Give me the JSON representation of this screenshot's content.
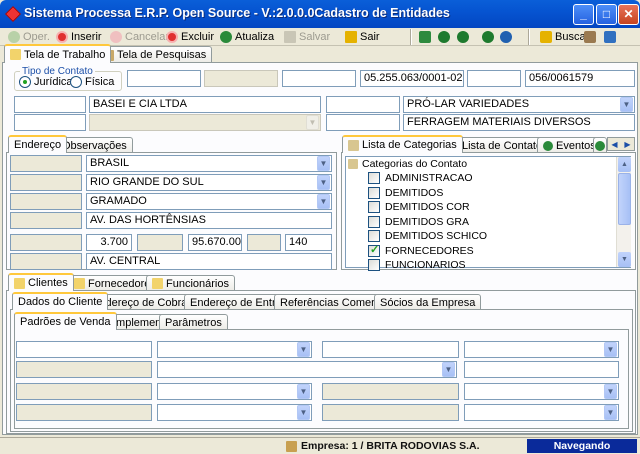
{
  "window": {
    "title": "Sistema Processa E.R.P. Open Source - V.:2.0.0.0Cadastro de Entidades",
    "minimize": "_",
    "maximize": "□",
    "close": "✕"
  },
  "toolbar": {
    "open": "Oper.",
    "insert": "Inserir",
    "cancel": "Cancelar",
    "delete": "Excluir",
    "update": "Atualiza",
    "save": "Salvar",
    "exit": "Sair",
    "search": "Busca"
  },
  "main_tabs": [
    "Tela de Trabalho",
    "Tela de Pesquisas"
  ],
  "contact_type": {
    "legend": "Tipo de Contato",
    "options": [
      "Jurídica",
      "Física"
    ],
    "selected": "Jurídica"
  },
  "header_fields": {
    "cnpj": "05.255.063/0001-02",
    "ie": "056/0061579",
    "razao_social": "BASEI E CIA LTDA",
    "fantasia": "PRÓ-LAR VARIEDADES",
    "ramo": "FERRAGEM MATERIAIS DIVERSOS"
  },
  "address_tabs": [
    "Endereço",
    "Observações"
  ],
  "address": {
    "country": "BRASIL",
    "state": "RIO GRANDE DO SUL",
    "city": "GRAMADO",
    "street": "AV. DAS HORTÊNSIAS",
    "number": "3.700",
    "cep": "95.670.000",
    "complement": "140",
    "street2": "AV. CENTRAL"
  },
  "right_tabs": [
    "Lista de Categorias",
    "Lista de Contatos",
    "Eventos"
  ],
  "categories": {
    "header": "Categorias do Contato",
    "items": [
      {
        "label": "ADMINISTRACAO",
        "checked": false
      },
      {
        "label": "DEMITIDOS",
        "checked": false
      },
      {
        "label": "DEMITIDOS COR",
        "checked": false
      },
      {
        "label": "DEMITIDOS GRA",
        "checked": false
      },
      {
        "label": "DEMITIDOS SCHICO",
        "checked": false
      },
      {
        "label": "FORNECEDORES",
        "checked": true
      },
      {
        "label": "FUNCIONARIOS",
        "checked": false
      }
    ]
  },
  "entity_tabs": [
    "Clientes",
    "Fornecedores",
    "Funcionários"
  ],
  "client_tabs": [
    "Dados do Cliente",
    "Endereço de Cobrança",
    "Endereço de Entrega",
    "Referências Comerciais",
    "Sócios da Empresa"
  ],
  "sales_tabs": [
    "Padrões de Venda",
    "Complementos",
    "Parâmetros"
  ],
  "status": {
    "company": "Empresa: 1 / BRITA RODOVIAS S.A.",
    "mode": "Navegando"
  }
}
